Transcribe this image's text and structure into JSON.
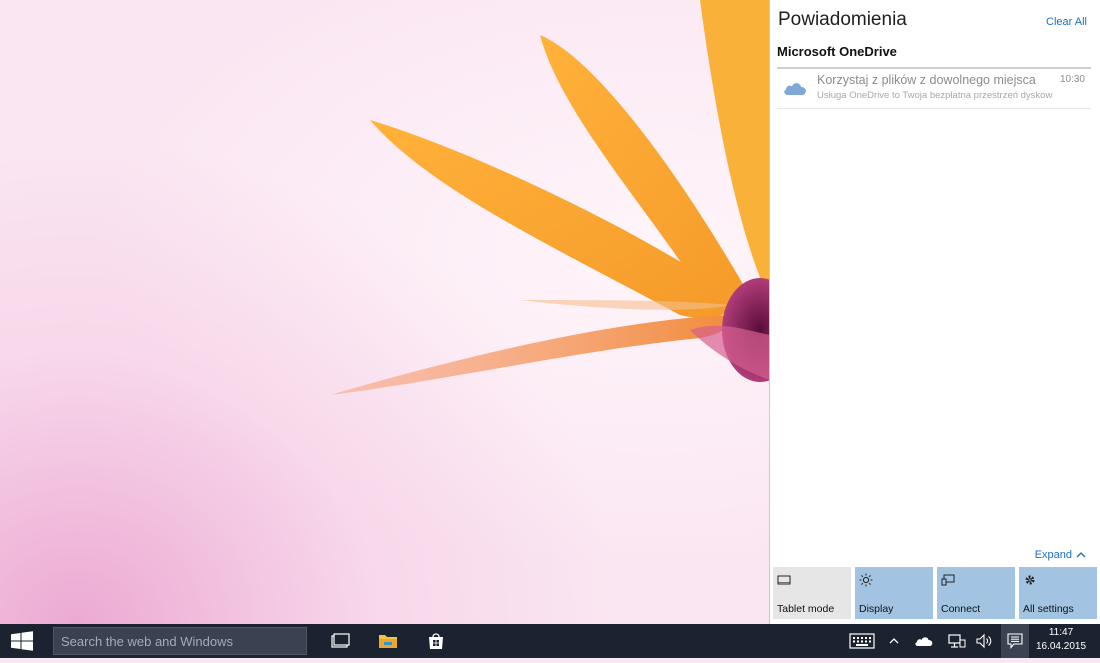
{
  "action_center": {
    "title": "Powiadomienia",
    "clear_all": "Clear All",
    "groups": [
      {
        "app": "Microsoft OneDrive",
        "notifications": [
          {
            "icon": "onedrive-cloud-icon",
            "title": "Korzystaj z plików z dowolnego miejsca",
            "body": "Usługa OneDrive to Twoja bezpłatna przestrzeń dyskowa",
            "time": "10:30"
          }
        ]
      }
    ],
    "expand_label": "Expand",
    "quick_actions": [
      {
        "label": "Tablet mode",
        "icon": "tablet-mode-icon",
        "state": "off"
      },
      {
        "label": "Display",
        "icon": "brightness-icon",
        "state": "on"
      },
      {
        "label": "Connect",
        "icon": "connect-icon",
        "state": "on"
      },
      {
        "label": "All settings",
        "icon": "gear-icon",
        "state": "on"
      }
    ]
  },
  "taskbar": {
    "search_placeholder": "Search the web and Windows",
    "clock_time": "11:47",
    "clock_date": "16.04.2015"
  },
  "colors": {
    "accent": "#1a6fc4",
    "quick_action_on": "#a2c4e2",
    "quick_action_off": "#e6e6e6",
    "taskbar": "#1c2330"
  }
}
